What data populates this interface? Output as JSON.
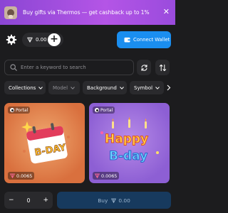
{
  "banner": {
    "text": "Buy gifts via Thermos — get cashback up to 1%",
    "close_glyph": "✕"
  },
  "header": {
    "balance": "0.00",
    "plus_glyph": "+",
    "connect_label": "Connect Wallet"
  },
  "search": {
    "placeholder": "Enter a keyword to search"
  },
  "filters": [
    {
      "label": "Collections"
    },
    {
      "label": "Model"
    },
    {
      "label": "Background"
    },
    {
      "label": "Symbol"
    }
  ],
  "cards": [
    {
      "tag": "Portal",
      "price": "0.0065",
      "art": "calendar-b-day"
    },
    {
      "tag": "Portal",
      "price": "0.0065",
      "art": "happy-b-day-text"
    }
  ],
  "footer": {
    "minus": "−",
    "quantity": "0",
    "plus": "+",
    "buy_label": "Buy",
    "buy_amount": "0.00"
  },
  "colors": {
    "banner": "#9a4bdd",
    "accent": "#1a8ef0",
    "background": "#1c1c1e",
    "surface": "#2a2a2d",
    "price_icon": "#ff6b9a"
  }
}
